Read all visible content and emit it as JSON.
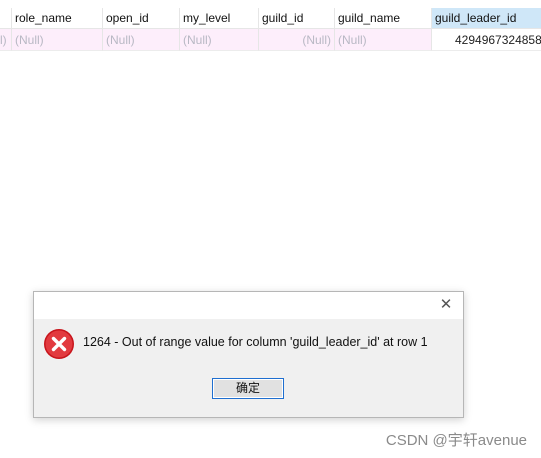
{
  "grid": {
    "columns": [
      "role_name",
      "open_id",
      "my_level",
      "guild_id",
      "guild_name",
      "guild_leader_id"
    ],
    "row": {
      "first_partial": "l)",
      "role_name": "(Null)",
      "open_id": "(Null)",
      "my_level": "(Null)",
      "guild_id": "(Null)",
      "guild_name": "(Null)",
      "guild_leader_id": "4294967324858"
    }
  },
  "dialog": {
    "message": "1264 - Out of range value for column 'guild_leader_id' at row 1",
    "ok_label": "确定",
    "close_glyph": "✕"
  },
  "watermark": "CSDN @宇轩avenue",
  "colors": {
    "selected_header": "#cfe7f8",
    "row_bg": "#fdeefb",
    "error_red": "#d9252b",
    "button_border": "#1f6fd0"
  }
}
